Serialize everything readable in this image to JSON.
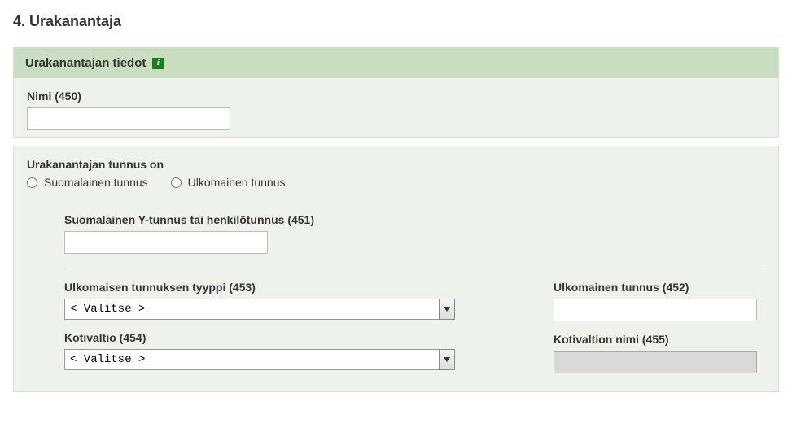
{
  "page": {
    "title": "4. Urakanantaja"
  },
  "section": {
    "header": "Urakanantajan tiedot"
  },
  "fields": {
    "name_label": "Nimi (450)",
    "name_value": "",
    "tunnus_group_label": "Urakanantajan tunnus on",
    "radio_fi": "Suomalainen tunnus",
    "radio_foreign": "Ulkomainen tunnus",
    "fi_id_label": "Suomalainen Y-tunnus tai henkilötunnus (451)",
    "fi_id_value": "",
    "foreign_type_label": "Ulkomaisen tunnuksen tyyppi (453)",
    "foreign_id_label": "Ulkomainen tunnus (452)",
    "foreign_id_value": "",
    "home_country_label": "Kotivaltio (454)",
    "home_country_name_label": "Kotivaltion nimi (455)",
    "home_country_name_value": "",
    "select_placeholder": "< Valitse >"
  }
}
